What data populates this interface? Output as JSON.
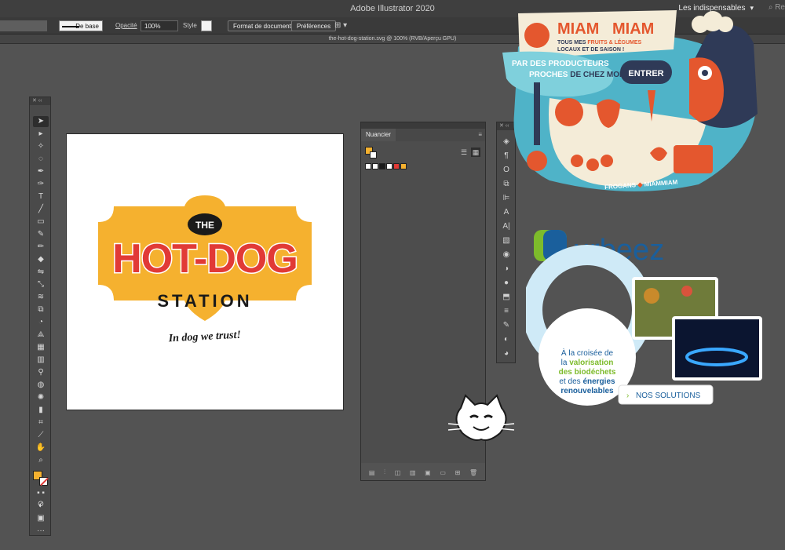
{
  "app": {
    "title": "Adobe Illustrator 2020",
    "workspace": "Les indispensables",
    "search_stub": "Re"
  },
  "controlbar": {
    "stroke_profile": "De base",
    "opacity_label": "Opacité",
    "opacity_value": "100%",
    "style_label": "Style",
    "format_button": "Format de document",
    "prefs_button": "Préférences"
  },
  "document": {
    "tab_title": "the-hot-dog-station.svg @ 100% (RVB/Aperçu GPU)"
  },
  "artwork": {
    "the": "THE",
    "hotdog": "HOT-DOG",
    "station": "STATION",
    "slogan": "In dog we trust!",
    "colors": {
      "orange": "#f5b12f",
      "red": "#e13a36",
      "black": "#1a1a1a"
    }
  },
  "swatches": {
    "tab_label": "Nuancier",
    "colors": [
      "#ffffff",
      "#1a1a1a",
      "#ffffff",
      "#e13a36",
      "#f5b12f"
    ]
  },
  "miammiam": {
    "logo_a": "MIAM",
    "logo_b": "MIAM",
    "tag1": "TOUS MES ",
    "tag1_hl": "FRUITS & LÉGUMES",
    "tag2": "LOCAUX ET DE SAISON !",
    "line1": "PAR DES PRODUCTEURS",
    "line2a": "PROCHES ",
    "line2b": "DE CHEZ MOI",
    "button": "ENTRER",
    "signature": "FROGANS",
    "signature2": "MIAMMIAM"
  },
  "urbeez": {
    "logo": "urbeez",
    "text1": "À la croisée de",
    "text2": "la ",
    "text2_hl": "valorisation",
    "text3": "des biodéchets",
    "text4": "et des ",
    "text4_hl": "énergies",
    "text5": "renouvelables",
    "button": "NOS SOLUTIONS",
    "colors": {
      "blue": "#1a5f9c",
      "green": "#7dbb2b",
      "light": "#cfeaf7"
    }
  }
}
